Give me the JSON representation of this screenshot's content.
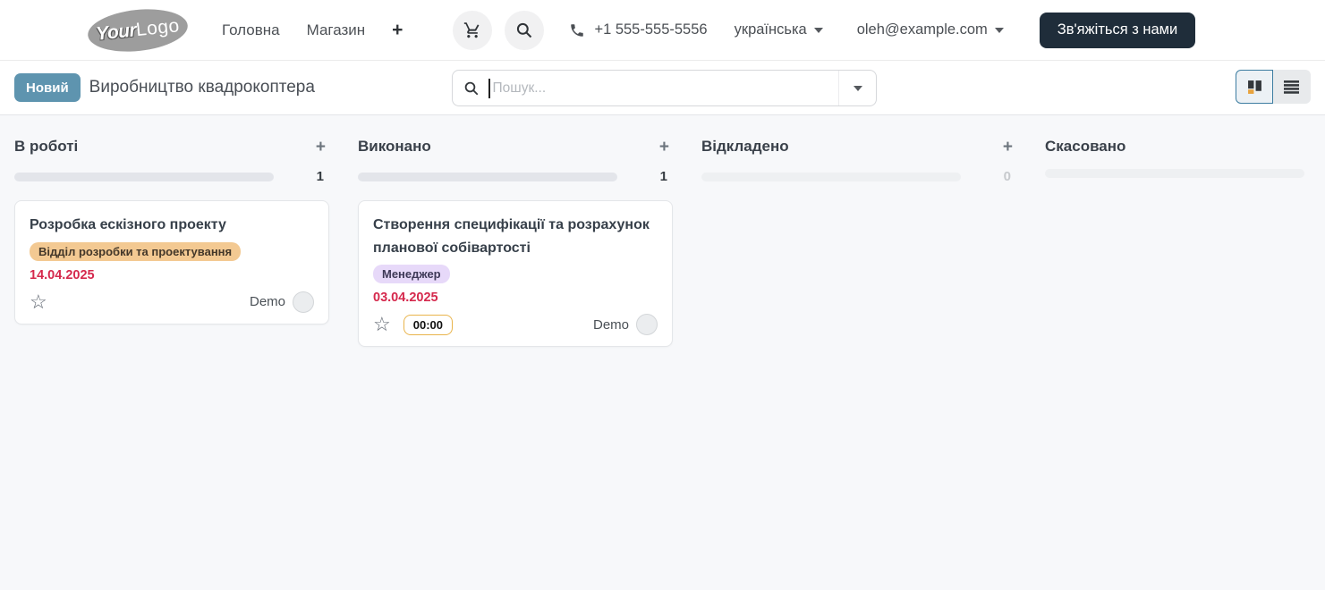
{
  "header": {
    "logo": {
      "bold": "Your",
      "light": "Logo"
    },
    "nav_items": [
      {
        "label": "Головна"
      },
      {
        "label": "Магазин"
      }
    ],
    "phone": "+1 555-555-5556",
    "language_selector": "українська",
    "account_selector": "oleh@example.com",
    "contact_button": "Зв'яжіться з нами"
  },
  "control_bar": {
    "new_button": "Новий",
    "page_title": "Виробництво квадрокоптера",
    "search": {
      "placeholder": "Пошук..."
    }
  },
  "board": {
    "columns": [
      {
        "title": "В роботі",
        "count": "1",
        "cards": [
          {
            "title": "Розробка ескізного проекту",
            "tag": "Відділ розробки та проектування",
            "date": "14.04.2025",
            "assignee": "Demo"
          }
        ]
      },
      {
        "title": "Виконано",
        "count": "1",
        "cards": [
          {
            "title": "Створення специфікації та розрахунок планової собівартості",
            "tag": "Менеджер",
            "date": "03.04.2025",
            "timer": "00:00",
            "assignee": "Demo"
          }
        ]
      },
      {
        "title": "Відкладено",
        "count": "0",
        "cards": []
      },
      {
        "title": "Скасовано",
        "count": "",
        "cards": []
      }
    ]
  },
  "icons": {
    "plus": "+",
    "star": "☆"
  },
  "colors": {
    "accent_blue": "#5e94af",
    "contact_button_bg": "#1f2d3a",
    "date_overdue": "#d5294d",
    "tag_department": "#f3c992",
    "tag_manager": "#e7d9f9",
    "timer_border": "#e9b44c",
    "view_active_border": "#3d7da1"
  }
}
